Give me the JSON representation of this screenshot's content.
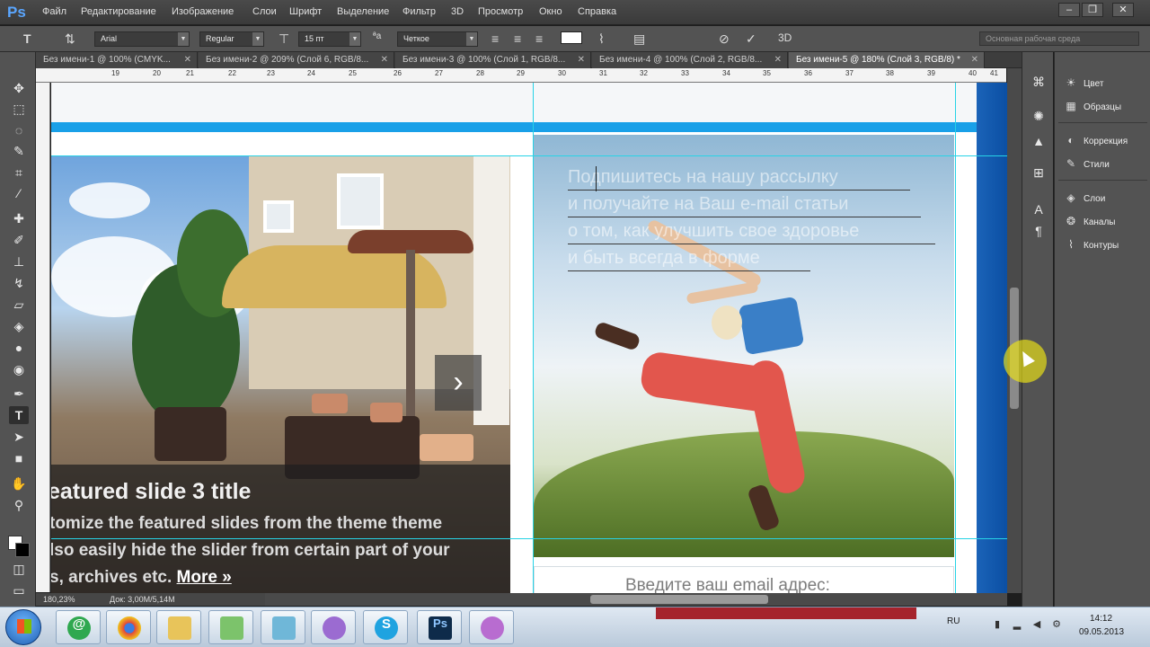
{
  "app": {
    "logo": "Ps",
    "menu": [
      "Файл",
      "Редактирование",
      "Изображение",
      "Слои",
      "Шрифт",
      "Выделение",
      "Фильтр",
      "3D",
      "Просмотр",
      "Окно",
      "Справка"
    ],
    "window_buttons": {
      "minimize": "–",
      "restore": "❐",
      "close": "✕"
    }
  },
  "options": {
    "font_family": "Arial",
    "font_style": "Regular",
    "font_size": "15 пт",
    "antialias": "Четкое",
    "workspace": "Основная рабочая среда",
    "threed_label": "3D"
  },
  "tabs": [
    {
      "label": "Без имени-1 @ 100% (CMYK...",
      "close": "✕",
      "active": false
    },
    {
      "label": "Без имени-2 @ 209% (Слой 6, RGB/8...",
      "close": "✕",
      "active": false
    },
    {
      "label": "Без имени-3 @ 100% (Слой 1, RGB/8...",
      "close": "✕",
      "active": false
    },
    {
      "label": "Без имени-4 @ 100% (Слой 2, RGB/8...",
      "close": "✕",
      "active": false
    },
    {
      "label": "Без имени-5 @ 180% (Слой 3, RGB/8) *",
      "close": "✕",
      "active": true
    }
  ],
  "ruler_numbers": [
    "19",
    "20",
    "21",
    "22",
    "23",
    "24",
    "25",
    "26",
    "27",
    "28",
    "29",
    "30",
    "31",
    "32",
    "33",
    "34",
    "35",
    "36",
    "37",
    "38",
    "39",
    "40",
    "41"
  ],
  "canvas": {
    "slide_title": "eatured slide 3 title",
    "slide_line1": "tomize the featured slides from the theme theme",
    "slide_line2": "lso easily hide the slider from certain part of your",
    "slide_line3_prefix": "s, archives etc. ",
    "slide_more": "More »",
    "slider_arrow": "›",
    "subscribe_lines": [
      "Подпишитесь на нашу рассылку",
      "и получайте на Ваш e-mail статьи",
      "о том, как улучшить свое здоровье",
      "и быть всегда в форме"
    ],
    "email_placeholder": "Введите ваш email адрес:"
  },
  "status": {
    "zoom": "180,23%",
    "doc_info": "Док: 3,00M/5,14M"
  },
  "panels": [
    {
      "label": "Цвет",
      "icon": "palette-icon"
    },
    {
      "label": "Образцы",
      "icon": "swatches-icon"
    },
    {
      "label": "Коррекция",
      "icon": "adjustments-icon"
    },
    {
      "label": "Стили",
      "icon": "styles-icon"
    },
    {
      "label": "Слои",
      "icon": "layers-icon"
    },
    {
      "label": "Каналы",
      "icon": "channels-icon"
    },
    {
      "label": "Контуры",
      "icon": "paths-icon"
    }
  ],
  "taskbar": {
    "language": "RU",
    "time": "14:12",
    "date": "09.05.2013"
  },
  "colors": {
    "accent_blue": "#19a0e8",
    "guide": "#27d3e6",
    "ps_panel": "#535353"
  }
}
